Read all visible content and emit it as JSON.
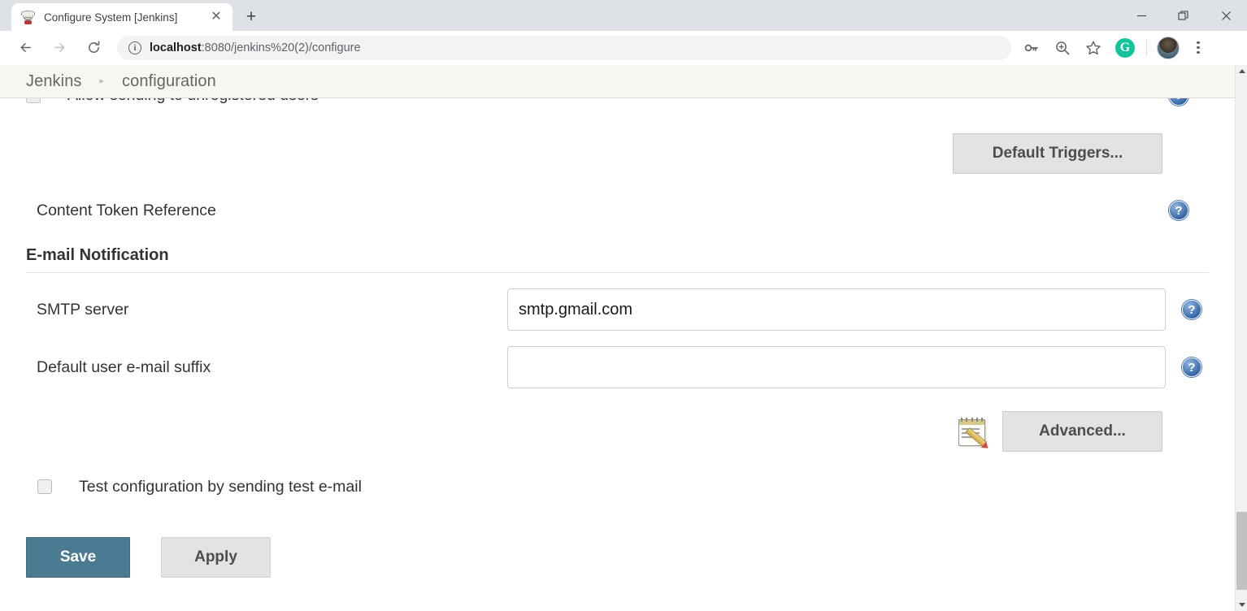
{
  "browser": {
    "tab": {
      "title": "Configure System [Jenkins]",
      "favicon": "jenkins-butler-icon",
      "close_label": "✕"
    },
    "newtab_label": "+",
    "window_controls": {
      "minimize": "minimize-icon",
      "restore": "restore-icon",
      "close": "close-icon"
    },
    "nav": {
      "back": "back-arrow-icon",
      "forward": "forward-arrow-icon",
      "reload": "reload-icon"
    },
    "omnibox": {
      "info_icon": "info-circle-icon",
      "url_host": "localhost",
      "url_path": ":8080/jenkins%20(2)/configure",
      "full_url": "localhost:8080/jenkins%20(2)/configure"
    },
    "toolbar_icons": {
      "password": "key-icon",
      "zoom": "magnifier-plus-icon",
      "bookmark": "star-icon",
      "grammarly": "G",
      "avatar": "user-avatar",
      "menu": "kebab-menu-icon"
    }
  },
  "breadcrumb": {
    "root": "Jenkins",
    "separator": "▸",
    "current": "configuration"
  },
  "form": {
    "clipped_row": {
      "label": "Allow sending to unregistered users",
      "checked": false
    },
    "default_triggers_button": "Default Triggers...",
    "content_token_reference": "Content Token Reference",
    "section": {
      "title": "E-mail Notification",
      "fields": [
        {
          "label": "SMTP server",
          "value": "smtp.gmail.com",
          "placeholder": ""
        },
        {
          "label": "Default user e-mail suffix",
          "value": "",
          "placeholder": ""
        }
      ],
      "advanced_button": "Advanced...",
      "advanced_icon": "notepad-pencil-icon",
      "test_checkbox": {
        "label": "Test configuration by sending test e-mail",
        "checked": false
      }
    },
    "actions": {
      "save": "Save",
      "apply": "Apply"
    },
    "help_icon_label": "?"
  },
  "colors": {
    "save_button": "#4a7b93",
    "breadcrumb_bg": "#f5f7f0",
    "help_icon": "#2f5e9e",
    "grammarly_green": "#15c39a"
  }
}
